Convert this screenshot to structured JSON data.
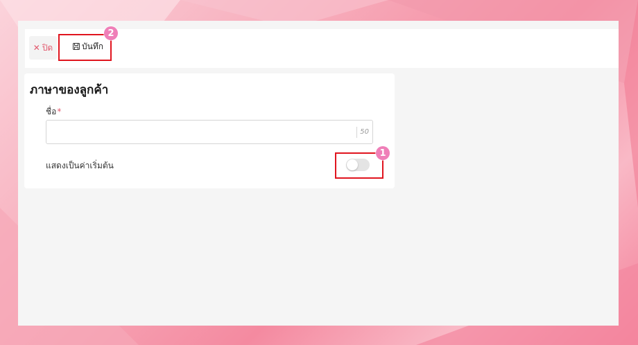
{
  "toolbar": {
    "close_label": "ปิด",
    "close_icon": "close-icon",
    "save_label": "บันทึก",
    "save_icon": "save-icon"
  },
  "form": {
    "title": "ภาษาของลูกค้า",
    "name_label": "ชื่อ",
    "name_required_mark": "*",
    "name_value": "",
    "name_max_length": "50",
    "default_toggle_label": "แสดงเป็นค่าเริ่มต้น",
    "default_toggle_on": false
  },
  "annotations": {
    "step1": "1",
    "step2": "2",
    "highlight_color": "#e0141e",
    "marker_color": "#ef7fb8"
  },
  "colors": {
    "accent": "#e25a6e",
    "page_bg": "#f5f5f5"
  }
}
